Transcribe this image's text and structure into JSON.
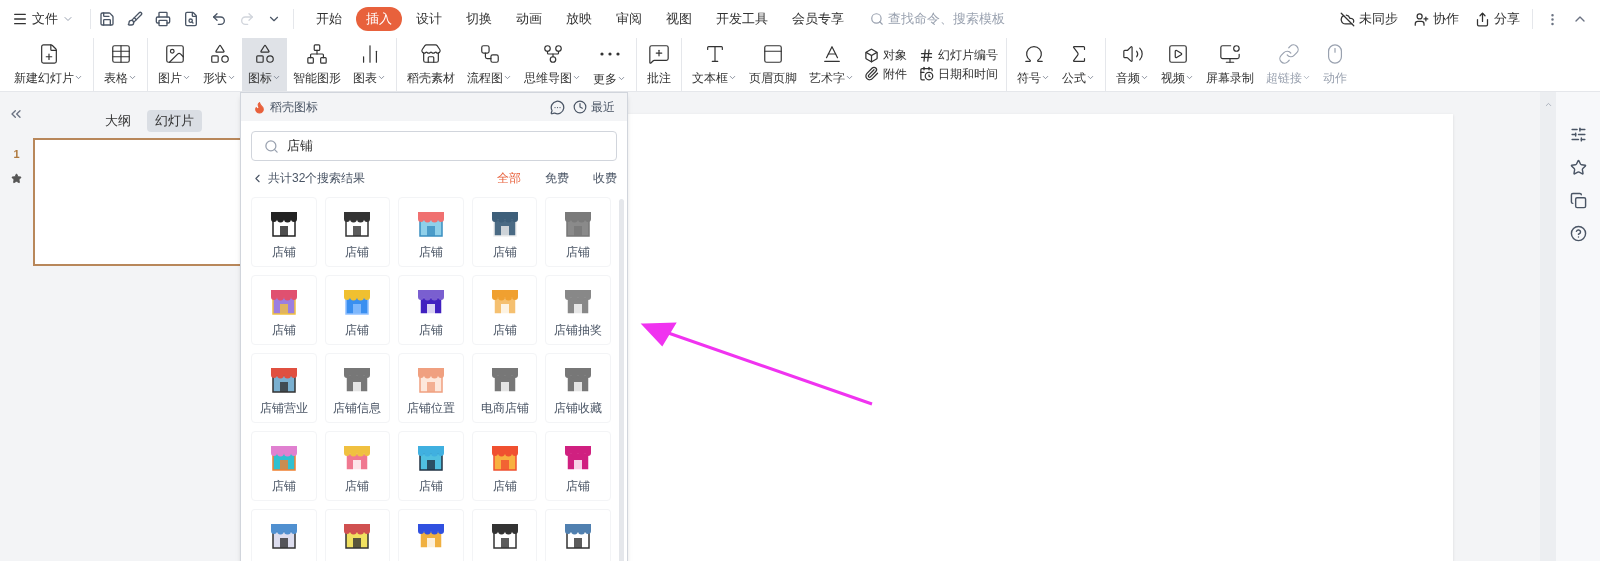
{
  "menu": {
    "file": "文件",
    "tabs": [
      {
        "label": "开始",
        "selected": false
      },
      {
        "label": "插入",
        "selected": true
      },
      {
        "label": "设计",
        "selected": false
      },
      {
        "label": "切换",
        "selected": false
      },
      {
        "label": "动画",
        "selected": false
      },
      {
        "label": "放映",
        "selected": false
      },
      {
        "label": "审阅",
        "selected": false
      },
      {
        "label": "视图",
        "selected": false
      },
      {
        "label": "开发工具",
        "selected": false
      },
      {
        "label": "会员专享",
        "selected": false
      }
    ],
    "search": {
      "placeholder": "查找命令、搜索模板"
    },
    "actions": [
      "未同步",
      "协作",
      "分享"
    ]
  },
  "ribbon": [
    [
      {
        "label": "新建幻灯片",
        "kind": "large",
        "dropdown": true,
        "pressed": false,
        "disabled": false
      }
    ],
    [
      {
        "label": "表格",
        "kind": "large",
        "dropdown": true,
        "pressed": false,
        "disabled": false
      }
    ],
    [
      {
        "label": "图片",
        "kind": "large",
        "dropdown": true,
        "pressed": false,
        "disabled": false
      },
      {
        "label": "形状",
        "kind": "large",
        "dropdown": true,
        "pressed": false,
        "disabled": false
      },
      {
        "label": "图标",
        "kind": "large",
        "dropdown": true,
        "pressed": true,
        "disabled": false
      },
      {
        "label": "智能图形",
        "kind": "large",
        "dropdown": false,
        "pressed": false,
        "disabled": false
      },
      {
        "label": "图表",
        "kind": "large",
        "dropdown": true,
        "pressed": false,
        "disabled": false
      }
    ],
    [
      {
        "label": "稻壳素材",
        "kind": "large",
        "dropdown": false,
        "pressed": false,
        "disabled": false
      },
      {
        "label": "流程图",
        "kind": "large",
        "dropdown": true,
        "pressed": false,
        "disabled": false
      },
      {
        "label": "思维导图",
        "kind": "large",
        "dropdown": true,
        "pressed": false,
        "disabled": false
      },
      {
        "label": "更多",
        "kind": "large",
        "dropdown": true,
        "pressed": false,
        "disabled": false
      }
    ],
    [
      {
        "label": "批注",
        "kind": "large",
        "dropdown": false,
        "pressed": false,
        "disabled": false
      }
    ],
    [
      {
        "label": "文本框",
        "kind": "large",
        "dropdown": true,
        "pressed": false,
        "disabled": false
      },
      {
        "label": "页眉页脚",
        "kind": "large",
        "dropdown": false,
        "pressed": false,
        "disabled": false
      },
      {
        "label": "艺术字",
        "kind": "large",
        "dropdown": true,
        "pressed": false,
        "disabled": false
      },
      {
        "label": "对象",
        "kind": "small",
        "dropdown": false,
        "pressed": false,
        "disabled": false
      },
      {
        "label": "附件",
        "kind": "small",
        "dropdown": false,
        "pressed": false,
        "disabled": false
      },
      {
        "label": "幻灯片编号",
        "kind": "small",
        "dropdown": false,
        "pressed": false,
        "disabled": false
      },
      {
        "label": "日期和时间",
        "kind": "small",
        "dropdown": false,
        "pressed": false,
        "disabled": false
      }
    ],
    [
      {
        "label": "符号",
        "kind": "large",
        "dropdown": true,
        "pressed": false,
        "disabled": false
      },
      {
        "label": "公式",
        "kind": "large",
        "dropdown": true,
        "pressed": false,
        "disabled": false
      }
    ],
    [
      {
        "label": "音频",
        "kind": "large",
        "dropdown": true,
        "pressed": false,
        "disabled": false
      },
      {
        "label": "视频",
        "kind": "large",
        "dropdown": true,
        "pressed": false,
        "disabled": false
      },
      {
        "label": "屏幕录制",
        "kind": "large",
        "dropdown": false,
        "pressed": false,
        "disabled": false
      },
      {
        "label": "超链接",
        "kind": "large",
        "dropdown": true,
        "pressed": false,
        "disabled": true
      },
      {
        "label": "动作",
        "kind": "large",
        "dropdown": false,
        "pressed": false,
        "disabled": true
      }
    ]
  ],
  "left_pane": {
    "tabs": [
      {
        "label": "大纲",
        "selected": false
      },
      {
        "label": "幻灯片",
        "selected": true
      }
    ],
    "slides": [
      {
        "number": "1",
        "selected": true
      }
    ]
  },
  "icon_panel": {
    "title": "稻壳图标",
    "recent": "最近",
    "search": {
      "value": "店铺"
    },
    "result_count": "共计32个搜索结果",
    "filters": [
      {
        "label": "全部",
        "selected": true
      },
      {
        "label": "免费",
        "selected": false
      },
      {
        "label": "收费",
        "selected": false
      }
    ],
    "items": [
      {
        "kind": "tile",
        "label": "店铺"
      },
      {
        "kind": "tile",
        "label": "店铺"
      },
      {
        "kind": "tile",
        "label": "店铺"
      },
      {
        "kind": "tile",
        "label": "店铺"
      },
      {
        "kind": "tile",
        "label": "店铺"
      },
      {
        "kind": "tile",
        "label": "店铺"
      },
      {
        "kind": "tile",
        "label": "店铺"
      },
      {
        "kind": "tile",
        "label": "店铺"
      },
      {
        "kind": "tile",
        "label": "店铺"
      },
      {
        "kind": "tile",
        "label": "店铺抽奖"
      },
      {
        "kind": "tile",
        "label": "店铺营业"
      },
      {
        "kind": "tile",
        "label": "店铺信息"
      },
      {
        "kind": "tile",
        "label": "店铺位置"
      },
      {
        "kind": "tile",
        "label": "电商店铺"
      },
      {
        "kind": "tile",
        "label": "店铺收藏"
      },
      {
        "kind": "tile",
        "label": "店铺"
      },
      {
        "kind": "tile",
        "label": "店铺"
      },
      {
        "kind": "tile",
        "label": "店铺"
      },
      {
        "kind": "tile",
        "label": "店铺"
      },
      {
        "kind": "tile",
        "label": "店铺"
      },
      {
        "kind": "cut"
      },
      {
        "kind": "cut"
      },
      {
        "kind": "cut"
      },
      {
        "kind": "cut"
      },
      {
        "kind": "cut"
      }
    ]
  }
}
